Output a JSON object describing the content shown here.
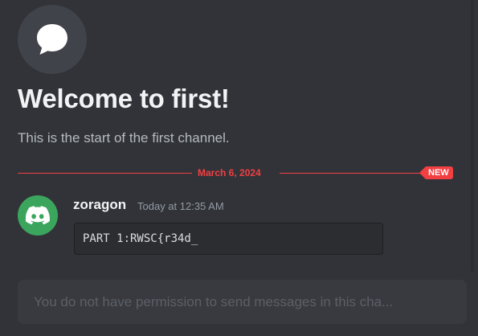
{
  "welcome": {
    "title": "Welcome to first!",
    "subtitle": "This is the start of the first channel."
  },
  "divider": {
    "date": "March 6, 2024",
    "new_label": "NEW"
  },
  "message": {
    "username": "zoragon",
    "timestamp": "Today at 12:35 AM",
    "code": "PART 1:RWSC{r34d_"
  },
  "composer": {
    "placeholder": "You do not have permission to send messages in this cha..."
  },
  "icons": {
    "channel": "chat-bubble-icon",
    "avatar": "discord-logo-icon"
  },
  "colors": {
    "background": "#313338",
    "accent_red": "#f23f42",
    "avatar_green": "#3ba55d"
  }
}
